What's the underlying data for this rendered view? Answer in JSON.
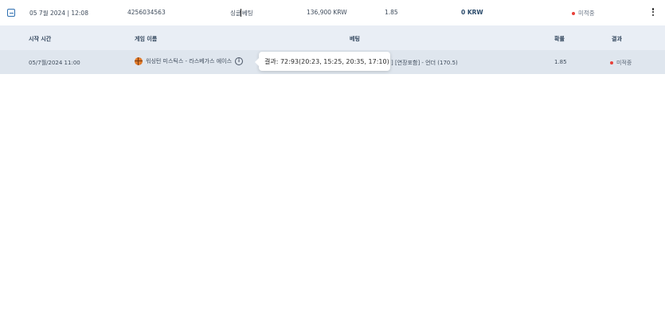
{
  "bet_row": {
    "datetime": "05 7월 2024 | 12:08",
    "bet_id": "4256034563",
    "type_before_cursor": "싱글",
    "type_after_cursor": "베팅",
    "stake": "136,900 KRW",
    "odds": "1.85",
    "winnings": "0 KRW",
    "status": "미적중",
    "status_color": "#e8413a"
  },
  "detail_header": {
    "start_time": "시작 시간",
    "game_name": "게임 이름",
    "bet": "베팅",
    "probability": "확률",
    "result": "결과"
  },
  "detail_row": {
    "start_time": "05/7월/2024 11:00",
    "game_name": "워싱턴 미스틱스 - 라스베가스 에이스",
    "bet_visible": "] [연장포함] - 언더 (170.5)",
    "probability": "1.85",
    "result": "미적중"
  },
  "tooltip": {
    "text": "결과: 72:93(20:23, 15:25, 20:35, 17:10)"
  }
}
